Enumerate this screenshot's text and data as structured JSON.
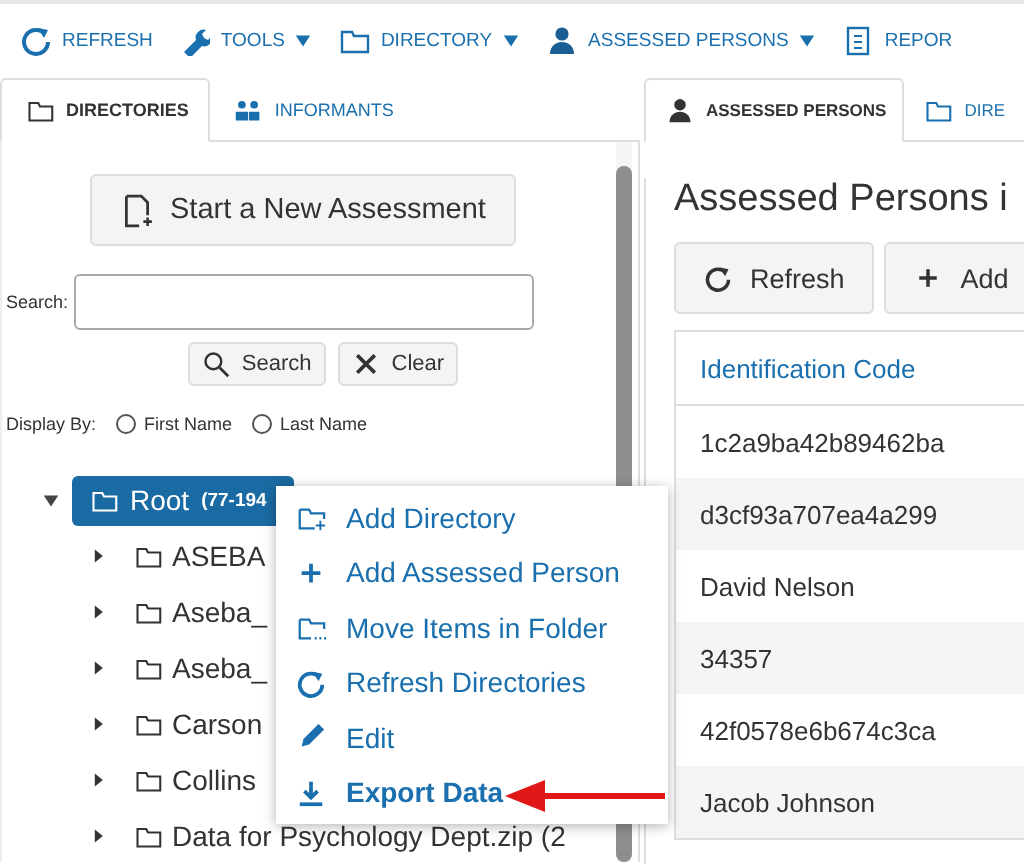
{
  "toolbar": [
    {
      "label": "REFRESH",
      "has_dropdown": false
    },
    {
      "label": "TOOLS",
      "has_dropdown": true
    },
    {
      "label": "DIRECTORY",
      "has_dropdown": true
    },
    {
      "label": "ASSESSED PERSONS",
      "has_dropdown": true
    },
    {
      "label": "REPOR",
      "has_dropdown": false
    }
  ],
  "left_panel": {
    "tabs": [
      {
        "label": "DIRECTORIES",
        "selected": true
      },
      {
        "label": "INFORMANTS",
        "selected": false
      }
    ],
    "new_assessment_button": "Start a New Assessment",
    "search": {
      "label": "Search:"
    },
    "search_button": "Search",
    "clear_button": "Clear",
    "display_by": {
      "label": "Display By:",
      "options": [
        {
          "label": "First Name",
          "selected": false
        },
        {
          "label": "Last Name",
          "selected": false
        }
      ]
    },
    "tree": {
      "label": "Root",
      "count": "(77-194",
      "expanded": true,
      "selected": true,
      "children": [
        {
          "label": "ASEBA",
          "expanded": false
        },
        {
          "label": "Aseba_",
          "expanded": false
        },
        {
          "label": "Aseba_",
          "expanded": false
        },
        {
          "label": "Carson",
          "expanded": false
        },
        {
          "label": "Collins",
          "expanded": false
        },
        {
          "label": "Data for Psychology Dept.zip (2",
          "expanded": false
        }
      ]
    }
  },
  "right_panel": {
    "tabs": [
      {
        "label": "ASSESSED PERSONS",
        "selected": true
      },
      {
        "label": "DIRE",
        "selected": false
      }
    ],
    "heading": "Assessed Persons i",
    "buttons": [
      "Refresh",
      "Add"
    ],
    "table": {
      "columns": [
        "Identification Code"
      ],
      "rows": [
        [
          "1c2a9ba42b89462ba"
        ],
        [
          "d3cf93a707ea4a299"
        ],
        [
          "David Nelson"
        ],
        [
          "34357"
        ],
        [
          "42f0578e6b674c3ca"
        ],
        [
          "Jacob Johnson"
        ]
      ]
    }
  },
  "context_menu": [
    {
      "label": "Add Directory",
      "highlighted": false
    },
    {
      "label": "Add Assessed Person",
      "highlighted": false
    },
    {
      "label": "Move Items in Folder",
      "highlighted": false
    },
    {
      "label": "Refresh Directories",
      "highlighted": false
    },
    {
      "label": "Edit",
      "highlighted": false
    },
    {
      "label": "Export Data",
      "highlighted": true
    }
  ]
}
